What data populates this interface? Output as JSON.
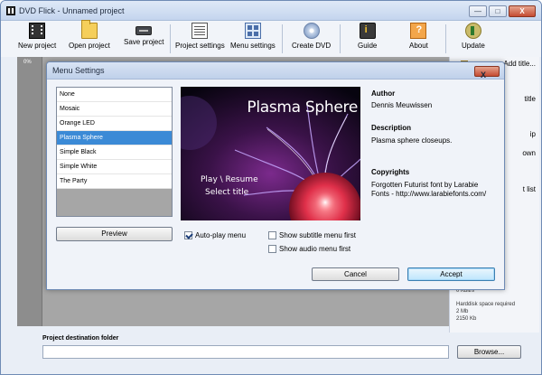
{
  "window": {
    "title": "DVD Flick - Unnamed project",
    "minimize_label": "—",
    "maximize_label": "□",
    "close_label": "X"
  },
  "toolbar": {
    "items": [
      {
        "label": "New project",
        "icon": "film-icon"
      },
      {
        "label": "Open project",
        "icon": "folder-icon"
      },
      {
        "label": "Save project",
        "icon": "save-icon"
      },
      {
        "label": "Project settings",
        "icon": "project-settings-icon"
      },
      {
        "label": "Menu settings",
        "icon": "menu-settings-icon"
      },
      {
        "label": "Create DVD",
        "icon": "dvd-icon"
      },
      {
        "label": "Guide",
        "icon": "guide-icon"
      },
      {
        "label": "About",
        "icon": "about-icon"
      },
      {
        "label": "Update",
        "icon": "update-icon"
      }
    ]
  },
  "progress": {
    "percent_label": "0%"
  },
  "right_panel": {
    "items": [
      "Add title...",
      "title",
      "ip",
      "own",
      "t list"
    ],
    "size_kbits": "0 Kbit/s",
    "harddisk_label": "Harddisk space required",
    "harddisk_mb": "2 Mb",
    "harddisk_kb": "2150 Kb"
  },
  "destination": {
    "label": "Project destination folder",
    "value": "",
    "browse_label": "Browse..."
  },
  "dialog": {
    "title": "Menu Settings",
    "close_label": "X",
    "menus": [
      "None",
      "Mosaic",
      "Orange LED",
      "Plasma Sphere",
      "Simple Black",
      "Simple White",
      "The Party"
    ],
    "selected_index": 3,
    "preview_button": "Preview",
    "preview": {
      "title": "Plasma Sphere",
      "play_label": "Play \\ Resume",
      "select_label": "Select title"
    },
    "options": {
      "autoplay": {
        "label": "Auto-play menu",
        "checked": true
      },
      "subtitle_first": {
        "label": "Show subtitle menu first",
        "checked": false
      },
      "audio_first": {
        "label": "Show audio menu first",
        "checked": false
      }
    },
    "info": {
      "author_heading": "Author",
      "author": "Dennis Meuwissen",
      "description_heading": "Description",
      "description": "Plasma sphere closeups.",
      "copyrights_heading": "Copyrights",
      "copyrights": "Forgotten Futurist font by Larabie Fonts - http://www.larabiefonts.com/"
    },
    "cancel_label": "Cancel",
    "accept_label": "Accept"
  },
  "colors": {
    "selection": "#3b8ad6",
    "title_bar": "#c4d5ee",
    "accept_button": "#bee6fd",
    "close_button": "#c54b32"
  }
}
